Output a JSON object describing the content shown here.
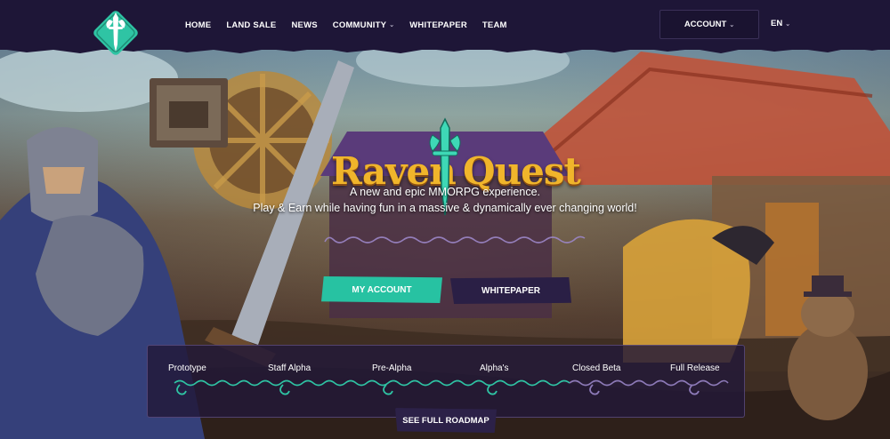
{
  "header": {
    "logo_icon": "sword-emblem-icon",
    "nav": [
      {
        "label": "HOME"
      },
      {
        "label": "LAND SALE"
      },
      {
        "label": "NEWS"
      },
      {
        "label": "COMMUNITY",
        "dropdown": true
      },
      {
        "label": "WHITEPAPER"
      },
      {
        "label": "TEAM"
      }
    ],
    "account_label": "ACCOUNT",
    "language": "EN"
  },
  "hero": {
    "logo": {
      "word_left": "Raven",
      "word_right": "Quest"
    },
    "tagline_line1": "A new and epic MMORPG experience.",
    "tagline_line2": "Play & Earn while having fun in a massive & dynamically ever changing world!",
    "primary_button": "MY ACCOUNT",
    "secondary_button": "WHITEPAPER"
  },
  "roadmap": {
    "stages": [
      "Prototype",
      "Staff Alpha",
      "Pre-Alpha",
      "Alpha's",
      "Closed Beta",
      "Full Release"
    ],
    "button": "SEE FULL ROADMAP"
  },
  "colors": {
    "header_bg": "#1e1637",
    "accent_teal": "#27c2a2",
    "logo_gold": "#f0b52b",
    "panel_bg": "#221838"
  }
}
